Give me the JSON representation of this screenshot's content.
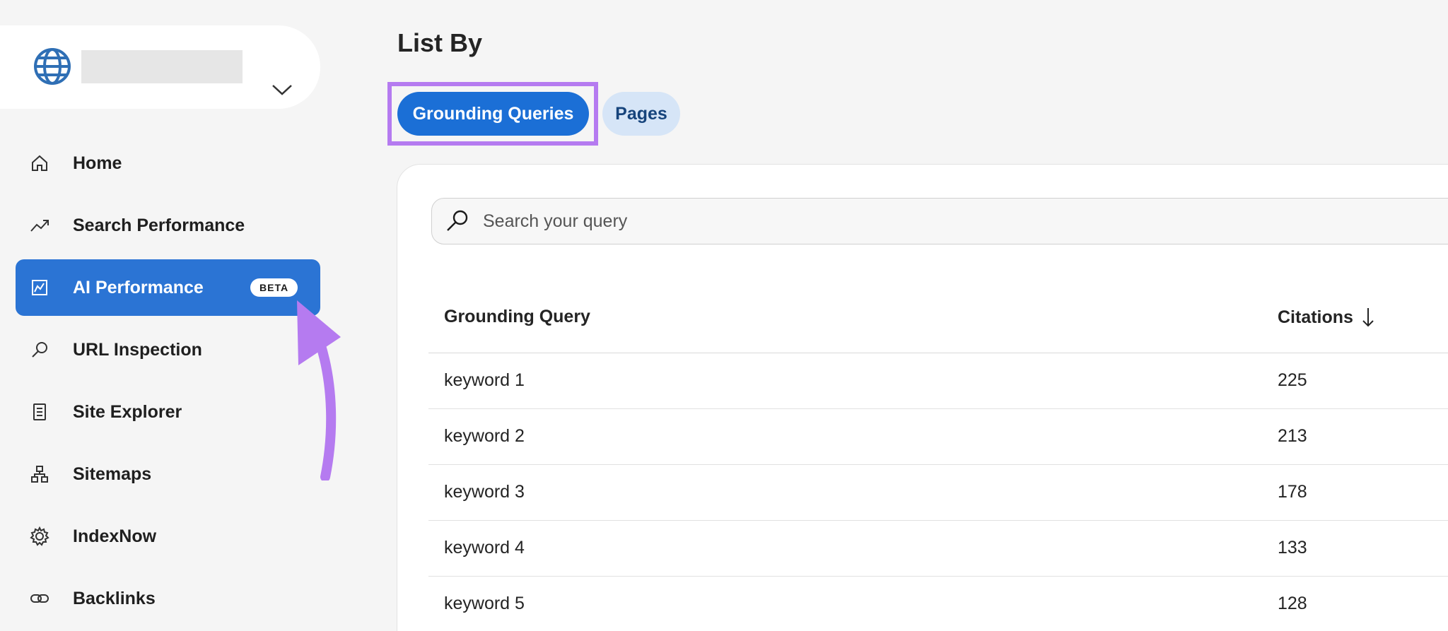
{
  "colors": {
    "accent": "#2b74d4",
    "pill_active": "#1b6fd6",
    "pill_inactive": "#d6e5f7",
    "annotation": "#b57bf0"
  },
  "site_selector": {
    "icon": "globe-icon",
    "chevron": "chevron-down-icon"
  },
  "nav": {
    "items": [
      {
        "label": "Home",
        "icon": "home-icon"
      },
      {
        "label": "Search Performance",
        "icon": "trending-up-icon"
      },
      {
        "label": "AI Performance",
        "icon": "chart-icon",
        "badge": "BETA",
        "active": true
      },
      {
        "label": "URL Inspection",
        "icon": "search-icon"
      },
      {
        "label": "Site Explorer",
        "icon": "document-list-icon"
      },
      {
        "label": "Sitemaps",
        "icon": "sitemap-icon"
      },
      {
        "label": "IndexNow",
        "icon": "gear-icon"
      },
      {
        "label": "Backlinks",
        "icon": "link-icon"
      }
    ]
  },
  "main": {
    "title": "List By",
    "tabs": [
      {
        "label": "Grounding Queries",
        "active": true
      },
      {
        "label": "Pages",
        "active": false
      }
    ],
    "search": {
      "placeholder": "Search your query",
      "value": ""
    },
    "table": {
      "columns": [
        "Grounding Query",
        "Citations"
      ],
      "sort_indicator": "↓",
      "rows": [
        {
          "query": "keyword 1",
          "citations": "225"
        },
        {
          "query": "keyword 2",
          "citations": "213"
        },
        {
          "query": "keyword 3",
          "citations": "178"
        },
        {
          "query": "keyword 4",
          "citations": "133"
        },
        {
          "query": "keyword 5",
          "citations": "128"
        }
      ]
    }
  }
}
